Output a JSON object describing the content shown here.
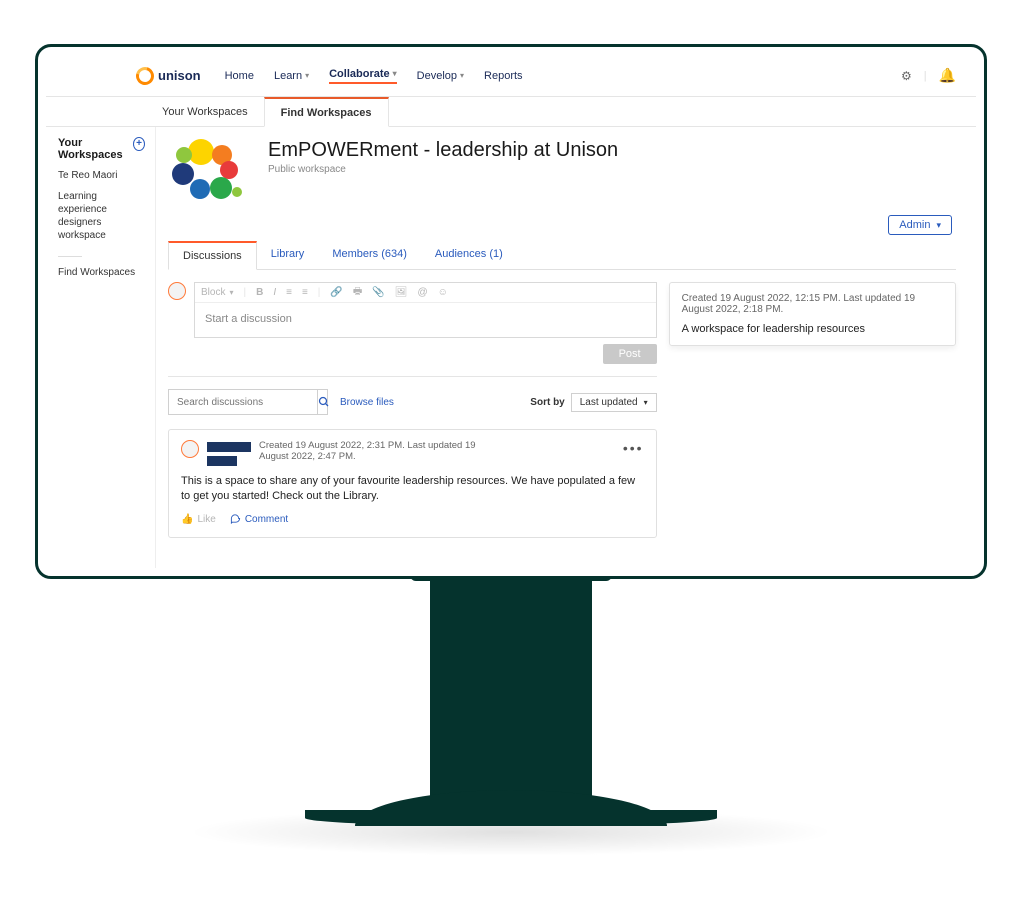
{
  "brand": {
    "name": "unison"
  },
  "nav": {
    "items": [
      {
        "label": "Home",
        "dropdown": false
      },
      {
        "label": "Learn",
        "dropdown": true
      },
      {
        "label": "Collaborate",
        "dropdown": true,
        "active": true
      },
      {
        "label": "Develop",
        "dropdown": true
      },
      {
        "label": "Reports",
        "dropdown": false
      }
    ]
  },
  "subtabs": {
    "your": "Your Workspaces",
    "find": "Find Workspaces"
  },
  "sidebar": {
    "heading": "Your Workspaces",
    "items": [
      "Te Reo Maori",
      "Learning experience designers workspace"
    ],
    "find": "Find Workspaces"
  },
  "workspace": {
    "title": "EmPOWERment - leadership at Unison",
    "subtitle": "Public workspace",
    "admin_label": "Admin"
  },
  "content_tabs": {
    "discussions": "Discussions",
    "library": "Library",
    "members": "Members (634)",
    "audiences": "Audiences (1)"
  },
  "compose": {
    "block_label": "Block",
    "placeholder": "Start a discussion",
    "post_label": "Post"
  },
  "search": {
    "placeholder": "Search discussions",
    "browse": "Browse files",
    "sort_label": "Sort by",
    "sort_value": "Last updated"
  },
  "info_card": {
    "meta": "Created 19 August 2022, 12:15 PM. Last updated 19 August 2022, 2:18 PM.",
    "desc": "A workspace for leadership resources"
  },
  "post": {
    "meta": "Created 19 August 2022, 2:31 PM. Last updated 19 August 2022, 2:47 PM.",
    "body": "This is a space to share any of your favourite leadership resources. We have populated a few to get you started! Check out the Library.",
    "like": "Like",
    "comment": "Comment"
  }
}
